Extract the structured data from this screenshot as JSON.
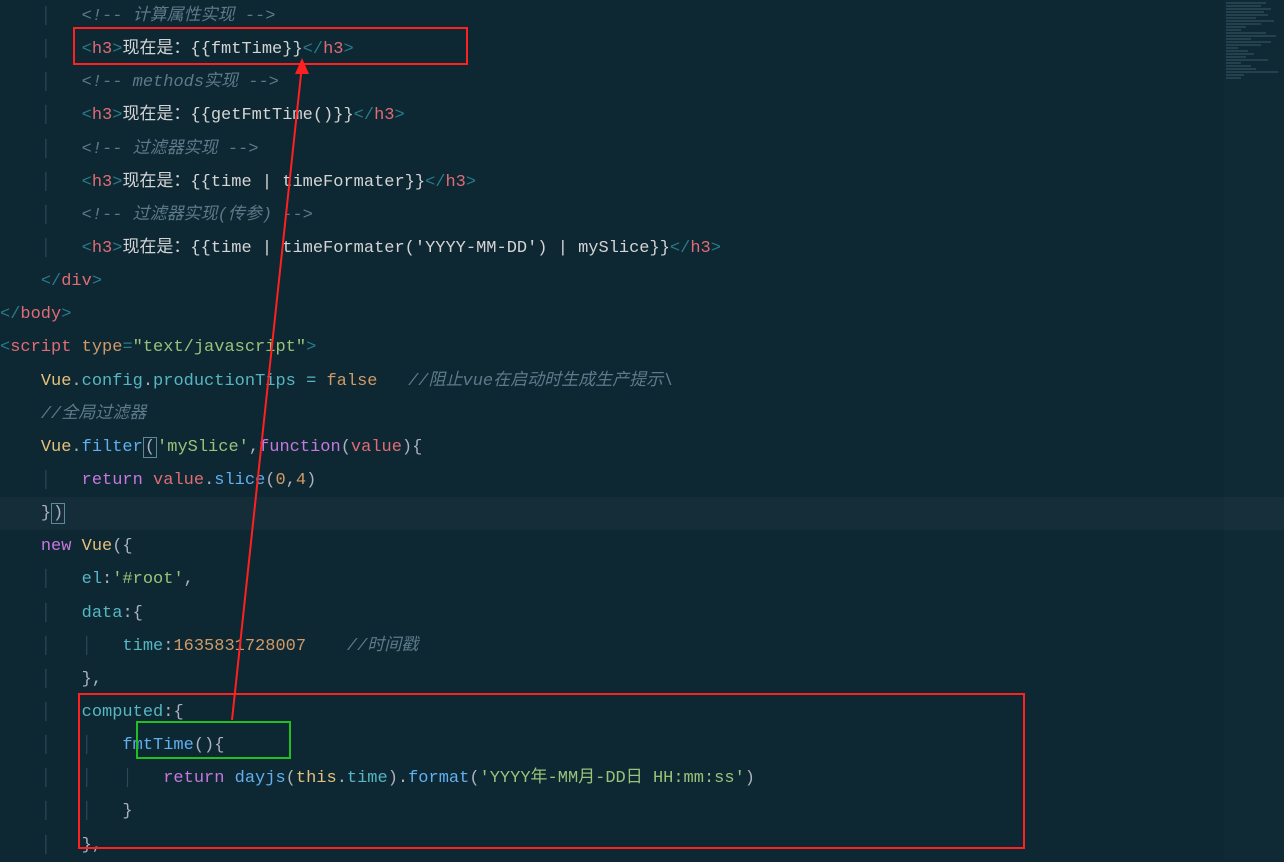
{
  "code": {
    "line1": {
      "indent": "        ",
      "comment": "<!-- 计算属性实现 -->"
    },
    "line2": {
      "indent": "        ",
      "tag": "h3",
      "text": "现在是：{{fmtTime}}"
    },
    "line3": {
      "indent": "        ",
      "comment": "<!-- methods实现 -->"
    },
    "line4": {
      "indent": "        ",
      "tag": "h3",
      "text": "现在是：{{getFmtTime()}}"
    },
    "line5": {
      "indent": "        ",
      "comment": "<!-- 过滤器实现 -->"
    },
    "line6": {
      "indent": "        ",
      "tag": "h3",
      "text": "现在是：{{time | timeFormater}}"
    },
    "line7": {
      "indent": "        ",
      "comment": "<!-- 过滤器实现(传参) -->"
    },
    "line8": {
      "indent": "        ",
      "tag": "h3",
      "text": "现在是：{{time | timeFormater('YYYY-MM-DD') | mySlice}}"
    },
    "line9": {
      "indent": "    ",
      "close_tag": "div"
    },
    "line10": {
      "indent": "",
      "close_tag": "body"
    },
    "line11": {
      "indent": "",
      "tag": "script",
      "attr": "type",
      "attr_val": "text/javascript"
    },
    "line12": {
      "indent": "    ",
      "js": "Vue.config.productionTips = false",
      "comment": "//阻止vue在启动时生成生产提示\\"
    },
    "line13": {
      "indent": "    ",
      "comment": "//全局过滤器"
    },
    "line14": {
      "indent": "    ",
      "js": "Vue.filter('mySlice',function(value){"
    },
    "line15": {
      "indent": "        ",
      "js": "return value.slice(0,4)"
    },
    "line16": {
      "indent": "    ",
      "js": "})"
    },
    "line17": {
      "indent": "    ",
      "js": "new Vue({"
    },
    "line18": {
      "indent": "        ",
      "js": "el:'#root',"
    },
    "line19": {
      "indent": "        ",
      "js": "data:{"
    },
    "line20": {
      "indent": "            ",
      "js": "time:1635831728007",
      "comment": "//时间戳"
    },
    "line21": {
      "indent": "        ",
      "js": "},"
    },
    "line22": {
      "indent": "        ",
      "js": "computed:{"
    },
    "line23": {
      "indent": "            ",
      "js": "fmtTime(){"
    },
    "line24": {
      "indent": "                ",
      "js": "return dayjs(this.time).format('YYYY年-MM月-DD日 HH:mm:ss')"
    },
    "line25": {
      "indent": "            ",
      "js": "}"
    },
    "line26": {
      "indent": "        ",
      "js": "},"
    }
  },
  "annotations": {
    "box1_highlight": "fmtTime template usage",
    "box2_highlight": "computed block",
    "box3_highlight": "fmtTime method"
  }
}
